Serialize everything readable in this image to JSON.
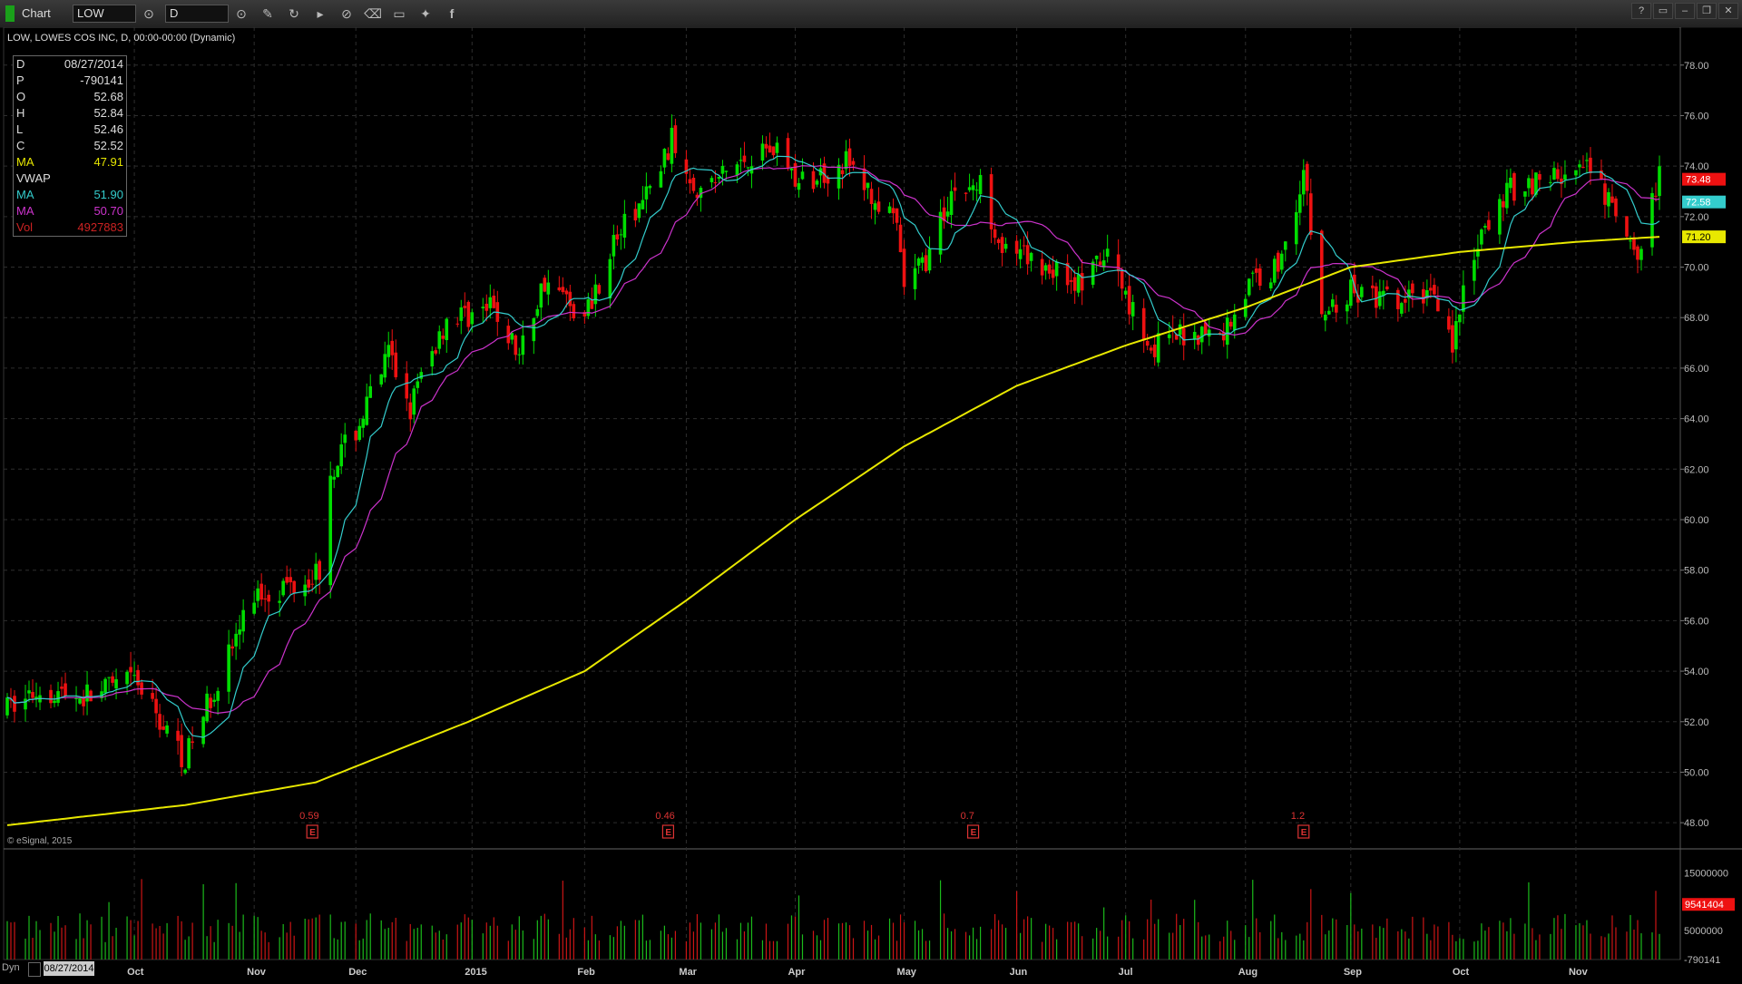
{
  "window": {
    "title": "Chart",
    "symbol_value": "LOW",
    "interval_value": "D",
    "controls": [
      "?",
      "▭",
      "–",
      "❐",
      "✕"
    ]
  },
  "header": {
    "symbol_line": "LOW, LOWES COS INC, D, 00:00-00:00 (Dynamic)"
  },
  "info_panel": [
    {
      "label": "D",
      "value": "08/27/2014",
      "color": "#dddddd"
    },
    {
      "label": "P",
      "value": "-790141",
      "color": "#dddddd"
    },
    {
      "label": "O",
      "value": "52.68",
      "color": "#dddddd"
    },
    {
      "label": "H",
      "value": "52.84",
      "color": "#dddddd"
    },
    {
      "label": "L",
      "value": "52.46",
      "color": "#dddddd"
    },
    {
      "label": "C",
      "value": "52.52",
      "color": "#dddddd"
    },
    {
      "label": "MA",
      "value": "47.91",
      "color": "#e6e600"
    },
    {
      "label": "VWAP",
      "value": "",
      "color": "#dddddd"
    },
    {
      "label": "MA",
      "value": "51.90",
      "color": "#33cccc"
    },
    {
      "label": "MA",
      "value": "50.70",
      "color": "#cc33cc"
    },
    {
      "label": "Vol",
      "value": "4927883",
      "color": "#cc2222"
    }
  ],
  "watermark": "© eSignal, 2015",
  "bottom": {
    "left_label": "Dyn",
    "date_box": "08/27/2014"
  },
  "colors": {
    "up": "#00dd00",
    "down": "#ee1111",
    "ma200": "#e8e800",
    "ma_fast": "#33cccc",
    "ma_mid": "#cc33cc"
  },
  "chart_data": {
    "type": "candlestick",
    "price_axis": {
      "range": [
        47.0,
        79.5
      ],
      "ticks": [
        "78.00",
        "76.00",
        "74.00",
        "72.00",
        "70.00",
        "68.00",
        "66.00",
        "64.00",
        "62.00",
        "60.00",
        "58.00",
        "56.00",
        "54.00",
        "52.00",
        "50.00",
        "48.00"
      ]
    },
    "time_axis": {
      "range": [
        "2014-08-27",
        "2015-11-25"
      ],
      "labels": [
        {
          "label": "Oct",
          "date": "2014-10-01"
        },
        {
          "label": "Nov",
          "date": "2014-11-03"
        },
        {
          "label": "Dec",
          "date": "2014-12-01"
        },
        {
          "label": "2015",
          "date": "2015-01-02"
        },
        {
          "label": "Feb",
          "date": "2015-02-02"
        },
        {
          "label": "Mar",
          "date": "2015-03-02"
        },
        {
          "label": "Apr",
          "date": "2015-04-01"
        },
        {
          "label": "May",
          "date": "2015-05-01"
        },
        {
          "label": "Jun",
          "date": "2015-06-01"
        },
        {
          "label": "Jul",
          "date": "2015-07-01"
        },
        {
          "label": "Aug",
          "date": "2015-08-03"
        },
        {
          "label": "Sep",
          "date": "2015-09-01"
        },
        {
          "label": "Oct",
          "date": "2015-10-01"
        },
        {
          "label": "Nov",
          "date": "2015-11-02"
        }
      ]
    },
    "price_key_points": [
      {
        "date": "2014-08-27",
        "price": 52.5
      },
      {
        "date": "2014-09-05",
        "price": 53.3
      },
      {
        "date": "2014-09-17",
        "price": 53.0
      },
      {
        "date": "2014-10-01",
        "price": 53.6
      },
      {
        "date": "2014-10-15",
        "price": 50.5
      },
      {
        "date": "2014-10-22",
        "price": 53.0
      },
      {
        "date": "2014-11-03",
        "price": 57.0
      },
      {
        "date": "2014-11-12",
        "price": 57.4
      },
      {
        "date": "2014-11-21",
        "price": 58.0
      },
      {
        "date": "2014-11-24",
        "price": 62.0
      },
      {
        "date": "2014-12-01",
        "price": 63.5
      },
      {
        "date": "2014-12-10",
        "price": 66.5
      },
      {
        "date": "2014-12-16",
        "price": 64.5
      },
      {
        "date": "2014-12-26",
        "price": 68.0
      },
      {
        "date": "2015-01-08",
        "price": 68.3
      },
      {
        "date": "2015-01-15",
        "price": 66.5
      },
      {
        "date": "2015-01-22",
        "price": 69.5
      },
      {
        "date": "2015-02-02",
        "price": 68.0
      },
      {
        "date": "2015-02-10",
        "price": 71.0
      },
      {
        "date": "2015-02-20",
        "price": 73.0
      },
      {
        "date": "2015-02-26",
        "price": 75.0
      },
      {
        "date": "2015-03-06",
        "price": 73.0
      },
      {
        "date": "2015-03-20",
        "price": 74.5
      },
      {
        "date": "2015-03-27",
        "price": 74.8
      },
      {
        "date": "2015-04-02",
        "price": 73.2
      },
      {
        "date": "2015-04-15",
        "price": 74.2
      },
      {
        "date": "2015-04-22",
        "price": 72.8
      },
      {
        "date": "2015-04-29",
        "price": 71.5
      },
      {
        "date": "2015-05-01",
        "price": 69.2
      },
      {
        "date": "2015-05-08",
        "price": 70.5
      },
      {
        "date": "2015-05-14",
        "price": 73.0
      },
      {
        "date": "2015-05-22",
        "price": 73.2
      },
      {
        "date": "2015-05-29",
        "price": 70.5
      },
      {
        "date": "2015-06-10",
        "price": 70.0
      },
      {
        "date": "2015-06-19",
        "price": 69.3
      },
      {
        "date": "2015-06-26",
        "price": 70.5
      },
      {
        "date": "2015-07-08",
        "price": 66.8
      },
      {
        "date": "2015-07-20",
        "price": 67.5
      },
      {
        "date": "2015-07-27",
        "price": 67.2
      },
      {
        "date": "2015-08-05",
        "price": 69.5
      },
      {
        "date": "2015-08-12",
        "price": 70.0
      },
      {
        "date": "2015-08-19",
        "price": 73.8
      },
      {
        "date": "2015-08-24",
        "price": 68.0
      },
      {
        "date": "2015-09-01",
        "price": 69.0
      },
      {
        "date": "2015-09-15",
        "price": 68.5
      },
      {
        "date": "2015-09-24",
        "price": 69.2
      },
      {
        "date": "2015-09-29",
        "price": 67.0
      },
      {
        "date": "2015-10-05",
        "price": 70.5
      },
      {
        "date": "2015-10-14",
        "price": 73.0
      },
      {
        "date": "2015-10-23",
        "price": 73.5
      },
      {
        "date": "2015-11-06",
        "price": 73.8
      },
      {
        "date": "2015-11-13",
        "price": 72.0
      },
      {
        "date": "2015-11-18",
        "price": 70.3
      },
      {
        "date": "2015-11-25",
        "price": 73.5
      }
    ],
    "ma200_key_points": [
      {
        "date": "2014-08-27",
        "price": 47.9
      },
      {
        "date": "2014-10-15",
        "price": 48.7
      },
      {
        "date": "2014-11-20",
        "price": 49.6
      },
      {
        "date": "2015-01-01",
        "price": 52.0
      },
      {
        "date": "2015-02-02",
        "price": 54.0
      },
      {
        "date": "2015-03-02",
        "price": 56.8
      },
      {
        "date": "2015-04-01",
        "price": 60.0
      },
      {
        "date": "2015-05-01",
        "price": 62.9
      },
      {
        "date": "2015-06-01",
        "price": 65.3
      },
      {
        "date": "2015-07-01",
        "price": 66.9
      },
      {
        "date": "2015-08-03",
        "price": 68.4
      },
      {
        "date": "2015-09-01",
        "price": 70.0
      },
      {
        "date": "2015-10-01",
        "price": 70.6
      },
      {
        "date": "2015-11-02",
        "price": 71.0
      },
      {
        "date": "2015-11-25",
        "price": 71.2
      }
    ],
    "price_tags": [
      {
        "value": "73.48",
        "color": "#ee1111"
      },
      {
        "value": "72.58",
        "color": "#33cccc"
      },
      {
        "value": "71.20",
        "color": "#e8e800"
      }
    ],
    "earnings_markers": [
      {
        "value": "0.59",
        "date": "2014-11-19"
      },
      {
        "value": "0.46",
        "date": "2015-02-25"
      },
      {
        "value": "0.7",
        "date": "2015-05-20"
      },
      {
        "value": "1.2",
        "date": "2015-08-19"
      }
    ],
    "volume_axis": {
      "ticks": [
        {
          "label": "15000000",
          "value": 15000000
        },
        {
          "label": "5000000",
          "value": 5000000
        },
        {
          "label": "-790141",
          "value": 0
        }
      ],
      "range": [
        0,
        19000000
      ]
    },
    "volume_tag": {
      "value": "9541404",
      "color": "#ee1111"
    }
  }
}
